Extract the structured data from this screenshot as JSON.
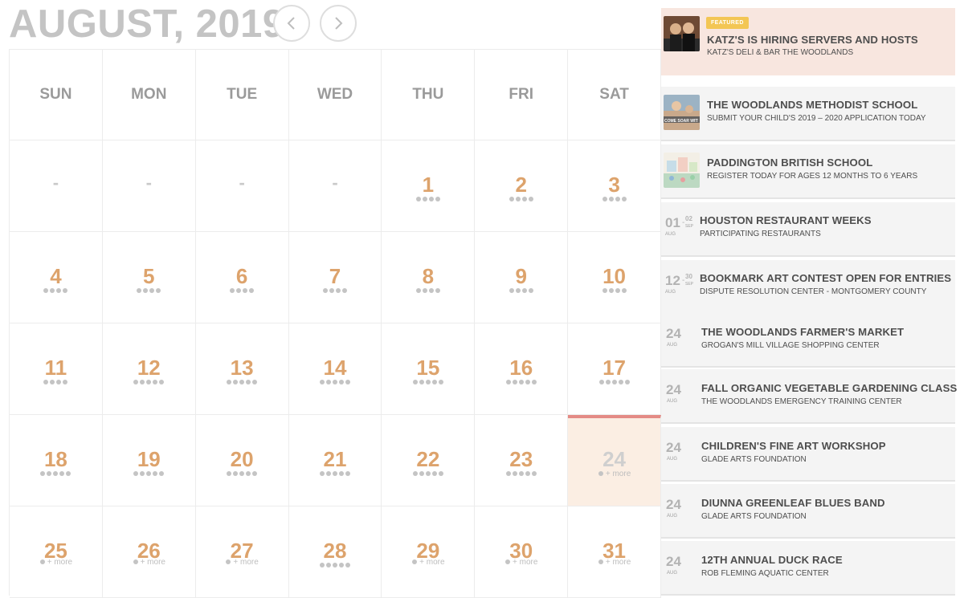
{
  "header": {
    "month_title": "AUGUST, 2019"
  },
  "weekdays": [
    "SUN",
    "MON",
    "TUE",
    "WED",
    "THU",
    "FRI",
    "SAT"
  ],
  "days": [
    {
      "label": "-",
      "dots": 0,
      "more": false,
      "empty": true
    },
    {
      "label": "-",
      "dots": 0,
      "more": false,
      "empty": true
    },
    {
      "label": "-",
      "dots": 0,
      "more": false,
      "empty": true
    },
    {
      "label": "-",
      "dots": 0,
      "more": false,
      "empty": true
    },
    {
      "label": "1",
      "dots": 4,
      "more": false
    },
    {
      "label": "2",
      "dots": 4,
      "more": false
    },
    {
      "label": "3",
      "dots": 4,
      "more": false
    },
    {
      "label": "4",
      "dots": 4,
      "more": false
    },
    {
      "label": "5",
      "dots": 4,
      "more": false
    },
    {
      "label": "6",
      "dots": 4,
      "more": false
    },
    {
      "label": "7",
      "dots": 4,
      "more": false
    },
    {
      "label": "8",
      "dots": 4,
      "more": false
    },
    {
      "label": "9",
      "dots": 4,
      "more": false
    },
    {
      "label": "10",
      "dots": 4,
      "more": false
    },
    {
      "label": "11",
      "dots": 4,
      "more": false
    },
    {
      "label": "12",
      "dots": 5,
      "more": false
    },
    {
      "label": "13",
      "dots": 5,
      "more": false
    },
    {
      "label": "14",
      "dots": 5,
      "more": false
    },
    {
      "label": "15",
      "dots": 5,
      "more": false
    },
    {
      "label": "16",
      "dots": 5,
      "more": false
    },
    {
      "label": "17",
      "dots": 5,
      "more": false
    },
    {
      "label": "18",
      "dots": 5,
      "more": false
    },
    {
      "label": "19",
      "dots": 5,
      "more": false
    },
    {
      "label": "20",
      "dots": 5,
      "more": false
    },
    {
      "label": "21",
      "dots": 5,
      "more": false
    },
    {
      "label": "22",
      "dots": 5,
      "more": false
    },
    {
      "label": "23",
      "dots": 5,
      "more": false
    },
    {
      "label": "24",
      "dots": 1,
      "more": true,
      "today": true
    },
    {
      "label": "25",
      "dots": 1,
      "more": true
    },
    {
      "label": "26",
      "dots": 1,
      "more": true
    },
    {
      "label": "27",
      "dots": 1,
      "more": true
    },
    {
      "label": "28",
      "dots": 5,
      "more": false
    },
    {
      "label": "29",
      "dots": 1,
      "more": true
    },
    {
      "label": "30",
      "dots": 1,
      "more": true
    },
    {
      "label": "31",
      "dots": 1,
      "more": true
    }
  ],
  "more_label": "+ more",
  "events": [
    {
      "kind": "featured",
      "badge": "FEATURED",
      "title": "KATZ'S IS HIRING SERVERS AND HOSTS",
      "subtitle": "KATZ'S DELI & BAR THE WOODLANDS",
      "thumb": "people-photo"
    },
    {
      "kind": "plain",
      "title": "THE WOODLANDS METHODIST SCHOOL",
      "subtitle": "SUBMIT YOUR CHILD'S 2019 – 2020 APPLICATION TODAY",
      "thumb": "school-photo"
    },
    {
      "kind": "plain",
      "title": "PADDINGTON BRITISH SCHOOL",
      "subtitle": "REGISTER TODAY FOR AGES 12 MONTHS TO 6 YEARS",
      "thumb": "school-illustration"
    },
    {
      "kind": "dated",
      "day": "01",
      "end_day": "02",
      "month": "AUG",
      "end_month": "SEP",
      "title": "HOUSTON RESTAURANT WEEKS",
      "subtitle": "PARTICIPATING RESTAURANTS"
    },
    {
      "kind": "dated",
      "day": "12",
      "end_day": "30",
      "month": "AUG",
      "end_month": "SEP",
      "title": "BOOKMARK ART CONTEST OPEN FOR ENTRIES",
      "subtitle": "DISPUTE RESOLUTION CENTER - MONTGOMERY COUNTY"
    },
    {
      "kind": "single",
      "day": "24",
      "month": "AUG",
      "title": "THE WOODLANDS FARMER'S MARKET",
      "subtitle": "GROGAN'S MILL VILLAGE SHOPPING CENTER"
    },
    {
      "kind": "single",
      "day": "24",
      "month": "AUG",
      "title": "FALL ORGANIC VEGETABLE GARDENING CLASS",
      "subtitle": "THE WOODLANDS EMERGENCY TRAINING CENTER"
    },
    {
      "kind": "single",
      "day": "24",
      "month": "AUG",
      "title": "CHILDREN'S FINE ART WORKSHOP",
      "subtitle": "GLADE ARTS FOUNDATION"
    },
    {
      "kind": "single",
      "day": "24",
      "month": "AUG",
      "title": "DIUNNA GREENLEAF BLUES BAND",
      "subtitle": "GLADE ARTS FOUNDATION"
    },
    {
      "kind": "single",
      "day": "24",
      "month": "AUG",
      "title": "12TH ANNUAL DUCK RACE",
      "subtitle": "ROB FLEMING AQUATIC CENTER"
    }
  ],
  "thumb_texts": {
    "school_photo": "COME SOAR WITH US"
  }
}
